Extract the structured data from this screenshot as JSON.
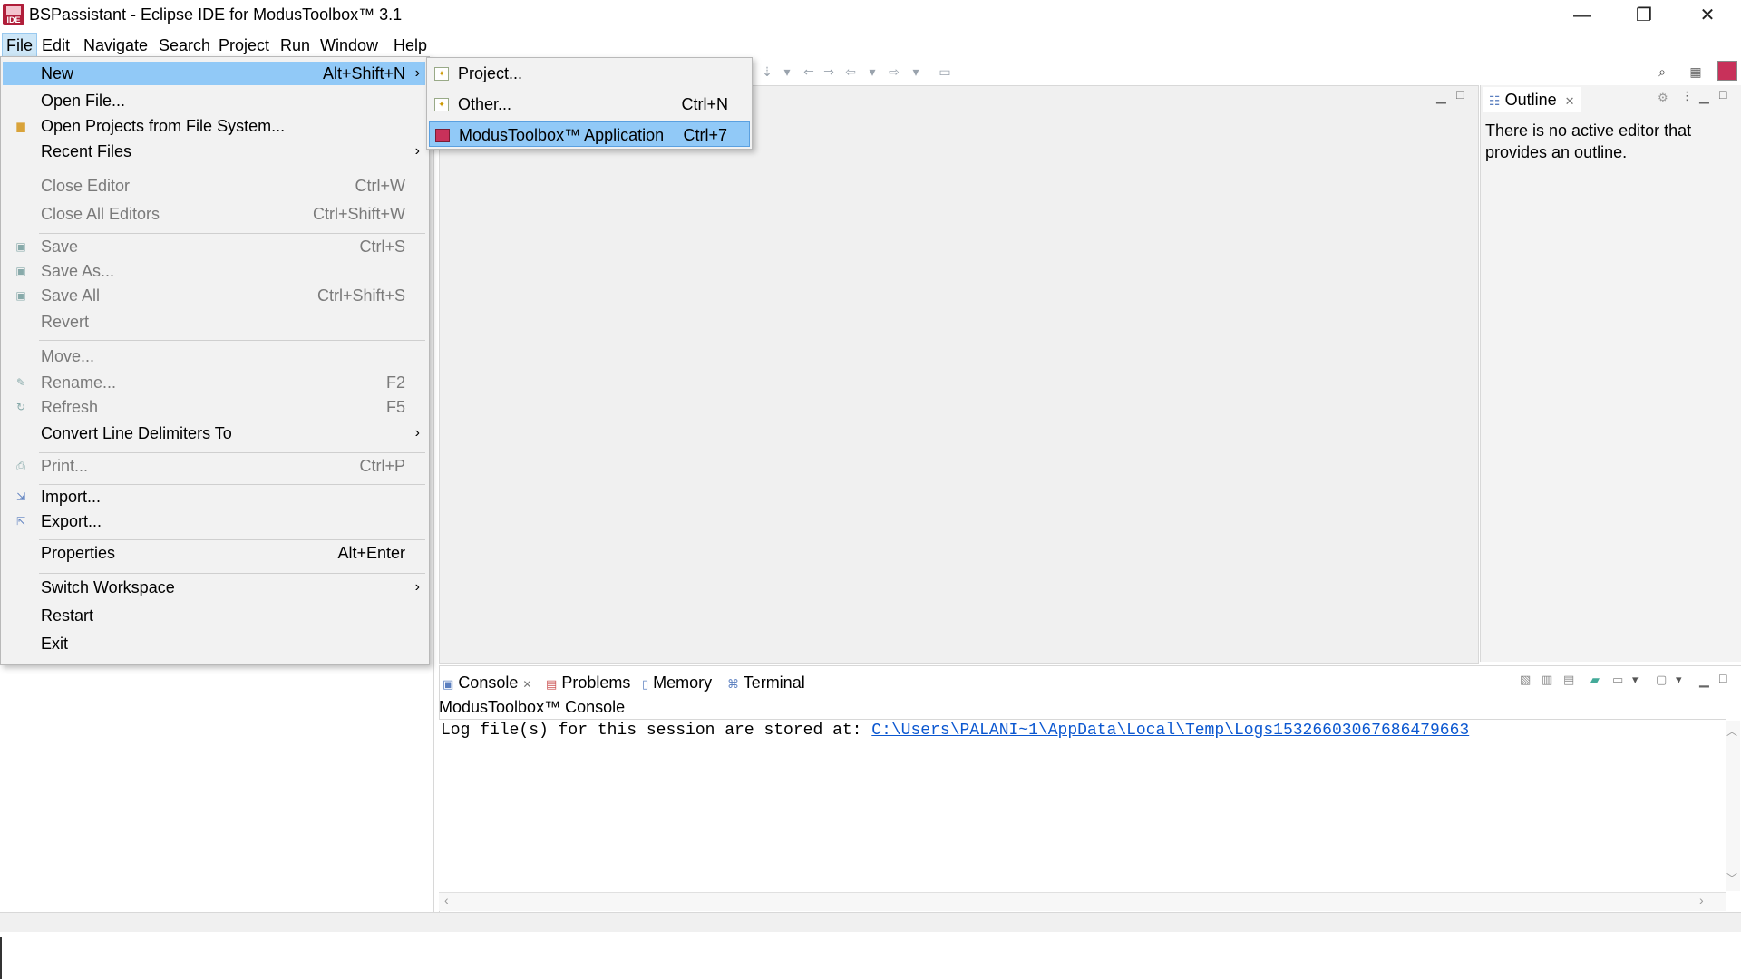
{
  "window": {
    "title": "BSPassistant - Eclipse IDE for ModusToolbox™ 3.1",
    "app_icon_label": "IDE",
    "minimize": "—",
    "restore": "❐",
    "close": "✕"
  },
  "menubar": [
    "File",
    "Edit",
    "Navigate",
    "Search",
    "Project",
    "Run",
    "Window",
    "Help"
  ],
  "file_menu": {
    "new": {
      "label": "New",
      "shortcut": "Alt+Shift+N"
    },
    "open_file": "Open File...",
    "open_projects": "Open Projects from File System...",
    "recent_files": "Recent Files",
    "close_editor": {
      "label": "Close Editor",
      "shortcut": "Ctrl+W"
    },
    "close_all_editors": {
      "label": "Close All Editors",
      "shortcut": "Ctrl+Shift+W"
    },
    "save": {
      "label": "Save",
      "shortcut": "Ctrl+S"
    },
    "save_as": "Save As...",
    "save_all": {
      "label": "Save All",
      "shortcut": "Ctrl+Shift+S"
    },
    "revert": "Revert",
    "move": "Move...",
    "rename": {
      "label": "Rename...",
      "shortcut": "F2"
    },
    "refresh": {
      "label": "Refresh",
      "shortcut": "F5"
    },
    "convert_line_delimiters": "Convert Line Delimiters To",
    "print": {
      "label": "Print...",
      "shortcut": "Ctrl+P"
    },
    "import": "Import...",
    "export": "Export...",
    "properties": {
      "label": "Properties",
      "shortcut": "Alt+Enter"
    },
    "switch_workspace": "Switch Workspace",
    "restart": "Restart",
    "exit": "Exit"
  },
  "new_submenu": {
    "project": "Project...",
    "other": {
      "label": "Other...",
      "shortcut": "Ctrl+N"
    },
    "modustoolbox_app": {
      "label": "ModusToolbox™ Application",
      "shortcut": "Ctrl+7"
    }
  },
  "outline": {
    "tab_label": "Outline",
    "message": "There is no active editor that provides an outline."
  },
  "console": {
    "tabs": [
      "Console",
      "Problems",
      "Memory",
      "Terminal"
    ],
    "header": "ModusToolbox™ Console",
    "log_prefix": "Log file(s) for this session are stored at: ",
    "log_path": "C:\\Users\\PALANI~1\\AppData\\Local\\Temp\\Logs15326603067686479663"
  },
  "colors": {
    "menu_highlight": "#91c9f7",
    "menu_bg": "#f2f2f2",
    "link": "#0b57d0"
  }
}
